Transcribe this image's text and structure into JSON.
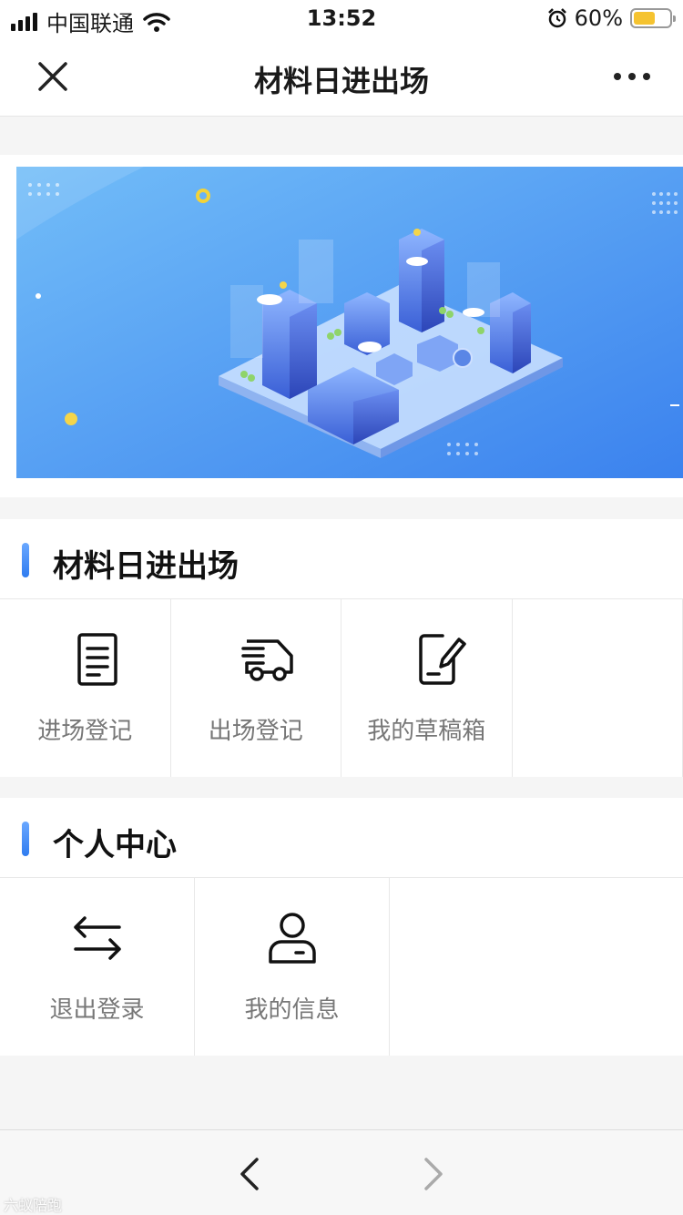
{
  "status_bar": {
    "carrier": "中国联通",
    "time": "13:52",
    "battery": "60%",
    "battery_level": 0.6
  },
  "nav": {
    "title": "材料日进出场",
    "close_icon": "close-icon",
    "more_icon": "more-icon"
  },
  "banner": {
    "image": "isometric-smart-city-illustration"
  },
  "section_materials": {
    "title": "材料日进出场",
    "items": [
      {
        "label": "进场登记",
        "icon": "document-icon"
      },
      {
        "label": "出场登记",
        "icon": "truck-icon"
      },
      {
        "label": "我的草稿箱",
        "icon": "draft-edit-icon"
      }
    ]
  },
  "section_personal": {
    "title": "个人中心",
    "items": [
      {
        "label": "退出登录",
        "icon": "switch-arrows-icon"
      },
      {
        "label": "我的信息",
        "icon": "user-icon"
      }
    ]
  },
  "toolbar": {
    "back_icon": "chevron-left-icon",
    "forward_icon": "chevron-right-icon"
  },
  "watermark": "六蚁陪跑",
  "colors": {
    "accent": "#3a86f5",
    "banner_start": "#6db5f7",
    "banner_end": "#3a83ee"
  }
}
